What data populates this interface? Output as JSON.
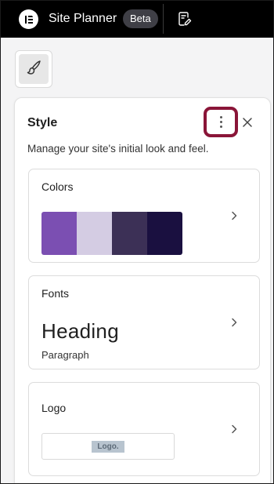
{
  "header": {
    "app_title": "Site Planner",
    "badge": "Beta",
    "icons": [
      "elementor-logo-icon",
      "page-edit-icon"
    ]
  },
  "canvas": {
    "tool_icon": "paintbrush-icon"
  },
  "style_panel": {
    "title": "Style",
    "description": "Manage your site's initial look and feel.",
    "menu_icon": "more-vertical-icon",
    "close_icon": "close-icon",
    "highlight_color": "#8a1538",
    "colors": {
      "title": "Colors",
      "palette": [
        "#7b4fb2",
        "#d4cce3",
        "#3c3056",
        "#1a1040"
      ]
    },
    "fonts": {
      "title": "Fonts",
      "heading_sample": "Heading",
      "paragraph_sample": "Paragraph"
    },
    "logo": {
      "title": "Logo",
      "placeholder_text": "Logo."
    }
  }
}
